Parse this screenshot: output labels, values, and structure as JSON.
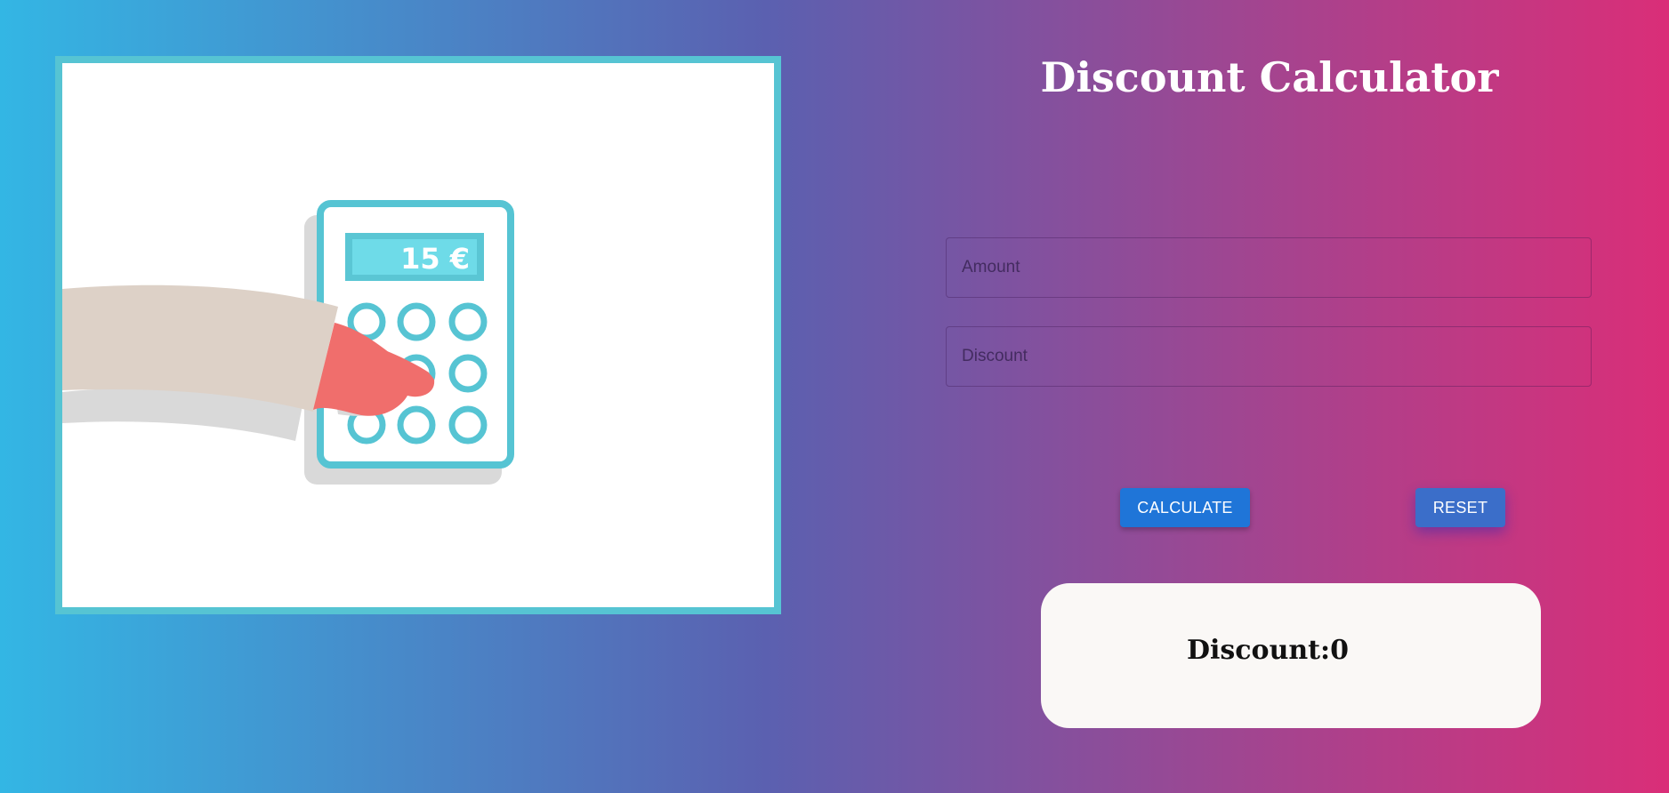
{
  "title": "Discount Calculator",
  "illustration": {
    "display_value": "15 €",
    "icon": "hand-pressing-calculator-illustration"
  },
  "form": {
    "amount_placeholder": "Amount",
    "discount_placeholder": "Discount"
  },
  "buttons": {
    "calculate_label": "CALCULATE",
    "reset_label": "RESET"
  },
  "result": {
    "text": "Discount:0"
  },
  "colors": {
    "gradient_start": "#33b6e4",
    "gradient_end": "#da2e78",
    "accent": "#56c4d3",
    "calculate_button": "#1f75d8",
    "reset_button": "#3b6ec9"
  }
}
